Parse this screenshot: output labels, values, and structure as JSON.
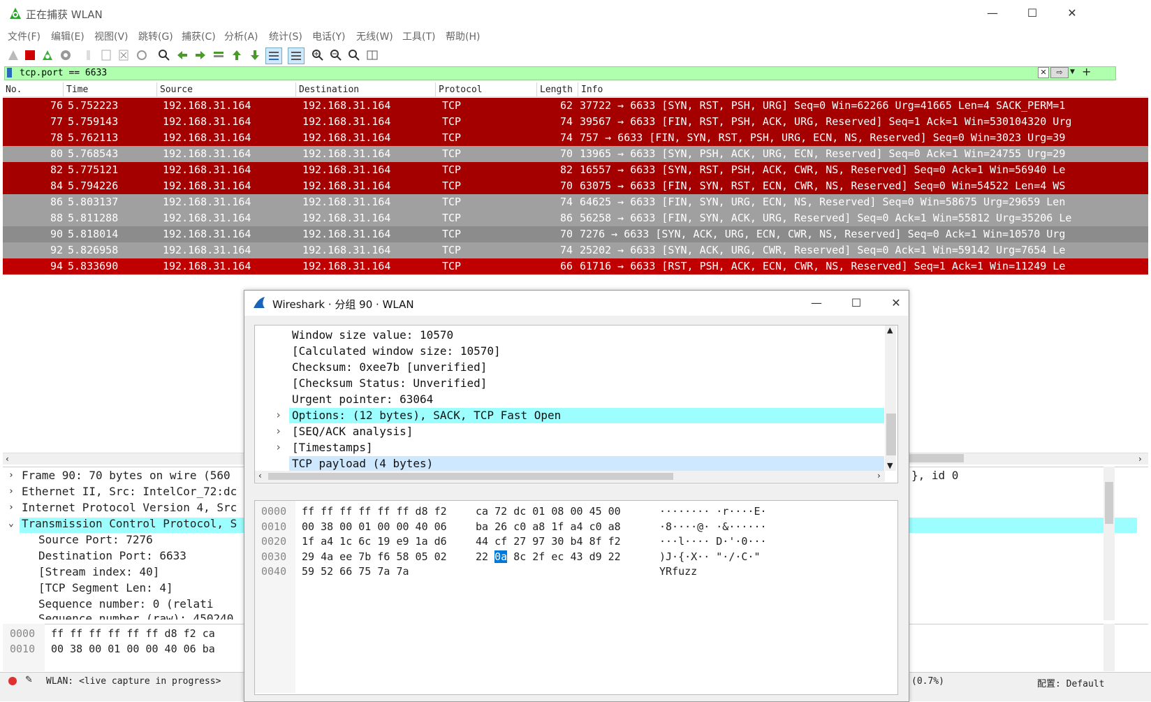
{
  "window": {
    "title": "正在捕获 WLAN",
    "minimize": "—",
    "maximize": "☐",
    "close": "✕"
  },
  "menu": [
    "文件(F)",
    "编辑(E)",
    "视图(V)",
    "跳转(G)",
    "捕获(C)",
    "分析(A)",
    "统计(S)",
    "电话(Y)",
    "无线(W)",
    "工具(T)",
    "帮助(H)"
  ],
  "filter": {
    "value": "tcp.port == 6633"
  },
  "packet_list": {
    "columns": [
      "No.",
      "Time",
      "Source",
      "Destination",
      "Protocol",
      "Length",
      "Info"
    ],
    "rows": [
      {
        "no": "76",
        "time": "5.752223",
        "src": "192.168.31.164",
        "dst": "192.168.31.164",
        "proto": "TCP",
        "len": "62",
        "info": "37722 → 6633 [SYN, RST, PSH, URG] Seq=0 Win=62266 Urg=41665 Len=4 SACK_PERM=1",
        "color": "#a40000"
      },
      {
        "no": "77",
        "time": "5.759143",
        "src": "192.168.31.164",
        "dst": "192.168.31.164",
        "proto": "TCP",
        "len": "74",
        "info": "39567 → 6633 [FIN, RST, PSH, ACK, URG, Reserved] Seq=1 Ack=1 Win=530104320 Urg",
        "color": "#a40000"
      },
      {
        "no": "78",
        "time": "5.762113",
        "src": "192.168.31.164",
        "dst": "192.168.31.164",
        "proto": "TCP",
        "len": "74",
        "info": "757 → 6633 [FIN, SYN, RST, PSH, URG, ECN, NS, Reserved] Seq=0 Win=3023 Urg=39",
        "color": "#a40000"
      },
      {
        "no": "80",
        "time": "5.768543",
        "src": "192.168.31.164",
        "dst": "192.168.31.164",
        "proto": "TCP",
        "len": "70",
        "info": "13965 → 6633 [SYN, PSH, ACK, URG, ECN, Reserved] Seq=0 Ack=1 Win=24755 Urg=29",
        "color": "#a0a0a0"
      },
      {
        "no": "82",
        "time": "5.775121",
        "src": "192.168.31.164",
        "dst": "192.168.31.164",
        "proto": "TCP",
        "len": "82",
        "info": "16557 → 6633 [SYN, RST, PSH, ACK, CWR, NS, Reserved] Seq=0 Ack=1 Win=56940 Le",
        "color": "#a40000"
      },
      {
        "no": "84",
        "time": "5.794226",
        "src": "192.168.31.164",
        "dst": "192.168.31.164",
        "proto": "TCP",
        "len": "70",
        "info": "63075 → 6633 [FIN, SYN, RST, ECN, CWR, NS, Reserved] Seq=0 Win=54522 Len=4 WS",
        "color": "#a40000"
      },
      {
        "no": "86",
        "time": "5.803137",
        "src": "192.168.31.164",
        "dst": "192.168.31.164",
        "proto": "TCP",
        "len": "74",
        "info": "64625 → 6633 [FIN, SYN, URG, ECN, NS, Reserved] Seq=0 Win=58675 Urg=29659 Len",
        "color": "#a0a0a0"
      },
      {
        "no": "88",
        "time": "5.811288",
        "src": "192.168.31.164",
        "dst": "192.168.31.164",
        "proto": "TCP",
        "len": "86",
        "info": "56258 → 6633 [FIN, SYN, ACK, URG, Reserved] Seq=0 Ack=1 Win=55812 Urg=35206 Le",
        "color": "#a0a0a0"
      },
      {
        "no": "90",
        "time": "5.818014",
        "src": "192.168.31.164",
        "dst": "192.168.31.164",
        "proto": "TCP",
        "len": "70",
        "info": "7276 → 6633 [SYN, ACK, URG, ECN, CWR, NS, Reserved] Seq=0 Ack=1 Win=10570 Urg",
        "color": "#8c8c8c"
      },
      {
        "no": "92",
        "time": "5.826958",
        "src": "192.168.31.164",
        "dst": "192.168.31.164",
        "proto": "TCP",
        "len": "74",
        "info": "25202 → 6633 [SYN, ACK, URG, CWR, Reserved] Seq=0 Ack=1 Win=59142 Urg=7654 Le",
        "color": "#a0a0a0"
      },
      {
        "no": "94",
        "time": "5.833690",
        "src": "192.168.31.164",
        "dst": "192.168.31.164",
        "proto": "TCP",
        "len": "66",
        "info": "61716 → 6633 [RST, PSH, ACK, ECN, CWR, NS, Reserved] Seq=1 Ack=1 Win=11249 Le",
        "color": "#c00000"
      }
    ]
  },
  "details": {
    "lines": [
      "Frame 90: 70 bytes on wire (560",
      "Ethernet II, Src: IntelCor_72:dc",
      "Internet Protocol Version 4, Src",
      "Transmission Control Protocol, S",
      "Source Port: 7276",
      "Destination Port: 6633",
      "[Stream index: 40]",
      "[TCP Segment Len: 4]",
      "Sequence number: 0    (relati",
      "Sequence number (raw): 450240"
    ],
    "right_text": "}, id 0"
  },
  "bottom_bytes": {
    "rows": [
      {
        "offset": "0000",
        "hex": "ff ff ff ff ff ff d8 f2  ca"
      },
      {
        "offset": "0010",
        "hex": "00 38 00 01 00 00 40 06  ba"
      }
    ]
  },
  "statusbar": {
    "left": "WLAN: <live capture in progress>",
    "pct": "(0.7%)",
    "profile": "配置: Default"
  },
  "dialog": {
    "title": "Wireshark · 分组 90 · WLAN",
    "tree": [
      {
        "text": "Window size value: 10570",
        "expand": false,
        "hl": ""
      },
      {
        "text": "[Calculated window size: 10570]",
        "expand": false,
        "hl": ""
      },
      {
        "text": "Checksum: 0xee7b [unverified]",
        "expand": false,
        "hl": ""
      },
      {
        "text": "[Checksum Status: Unverified]",
        "expand": false,
        "hl": ""
      },
      {
        "text": "Urgent pointer: 63064",
        "expand": false,
        "hl": ""
      },
      {
        "text": "Options: (12 bytes), SACK, TCP Fast Open",
        "expand": true,
        "hl": "#9cfefe"
      },
      {
        "text": "[SEQ/ACK analysis]",
        "expand": true,
        "hl": ""
      },
      {
        "text": "[Timestamps]",
        "expand": true,
        "hl": ""
      },
      {
        "text": "TCP payload (4 bytes)",
        "expand": false,
        "hl": "#cde8ff"
      }
    ],
    "bytes": [
      {
        "offset": "0000",
        "hex1": "ff ff ff ff ff ff d8 f2",
        "hex2": "ca 72 dc 01 08 00 45 00",
        "ascii": "········ ·r····E·"
      },
      {
        "offset": "0010",
        "hex1": "00 38 00 01 00 00 40 06",
        "hex2": "ba 26 c0 a8 1f a4 c0 a8",
        "ascii": "·8····@· ·&······"
      },
      {
        "offset": "0020",
        "hex1": "1f a4 1c 6c 19 e9 1a d6",
        "hex2": "44 cf 27 97 30 b4 8f f2",
        "ascii": "···l···· D·'·0···"
      },
      {
        "offset": "0030",
        "hex1": "29 4a ee 7b f6 58 05 02",
        "hex2": "22 0a 8c 2f ec 43 d9 22",
        "ascii": ")J·{·X·· \"·/·C·\""
      },
      {
        "offset": "0040",
        "hex1": "59 52 66 75 7a 7a",
        "hex2": "",
        "ascii": "YRfuzz"
      }
    ],
    "selected_byte": "0a"
  },
  "colors": {
    "accent_select": "#0078d7",
    "filter_bg": "#afffaf"
  }
}
